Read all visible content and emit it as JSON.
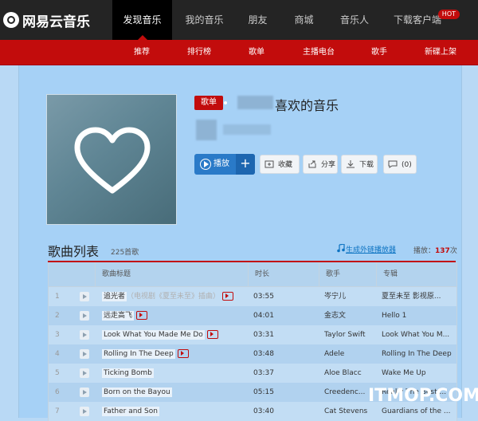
{
  "brand": {
    "name": "网易云音乐"
  },
  "nav": {
    "items": [
      "发现音乐",
      "我的音乐",
      "朋友",
      "商城",
      "音乐人",
      "下载客户端"
    ],
    "active": "发现音乐",
    "hot_badge": "HOT"
  },
  "subnav": {
    "items": [
      "推荐",
      "排行榜",
      "歌单",
      "主播电台",
      "歌手",
      "新碟上架"
    ],
    "active": "推荐"
  },
  "playlist": {
    "tag": "歌单",
    "title": "喜欢的音乐",
    "buttons": {
      "play": "播放",
      "add": "+",
      "collect": "收藏",
      "share": "分享",
      "download": "下载",
      "comment": "(0)"
    }
  },
  "songlist": {
    "title": "歌曲列表",
    "count": "225首歌",
    "external_link": "生成外链播放器",
    "play_label": "播放：",
    "play_count": "137",
    "play_unit": "次",
    "columns": [
      "歌曲标题",
      "时长",
      "歌手",
      "专辑"
    ],
    "rows": [
      {
        "num": "1",
        "title": "追光者",
        "alias": "（电视剧《夏至未至》插曲）",
        "mv": true,
        "duration": "03:55",
        "artist": "岑宁儿",
        "album": "夏至未至 影视原..."
      },
      {
        "num": "2",
        "title": "远走高飞",
        "alias": "",
        "mv": true,
        "duration": "04:01",
        "artist": "金志文",
        "album": "Hello 1"
      },
      {
        "num": "3",
        "title": "Look What You Made Me Do",
        "alias": "",
        "mv": true,
        "duration": "03:31",
        "artist": "Taylor Swift",
        "album": "Look What You M..."
      },
      {
        "num": "4",
        "title": "Rolling In The Deep",
        "alias": "",
        "mv": true,
        "duration": "03:48",
        "artist": "Adele",
        "album": "Rolling In The Deep"
      },
      {
        "num": "5",
        "title": "Ticking Bomb",
        "alias": "",
        "mv": false,
        "duration": "03:37",
        "artist": "Aloe Blacc",
        "album": "Wake Me Up"
      },
      {
        "num": "6",
        "title": "Born on the Bayou",
        "alias": "",
        "mv": false,
        "duration": "05:15",
        "artist": "Creedenc...",
        "album": "Really The Best ..."
      },
      {
        "num": "7",
        "title": "Father and Son",
        "alias": "",
        "mv": false,
        "duration": "03:40",
        "artist": "Cat Stevens",
        "album": "Guardians of the ..."
      }
    ]
  },
  "watermark": "ITMOP.COM"
}
